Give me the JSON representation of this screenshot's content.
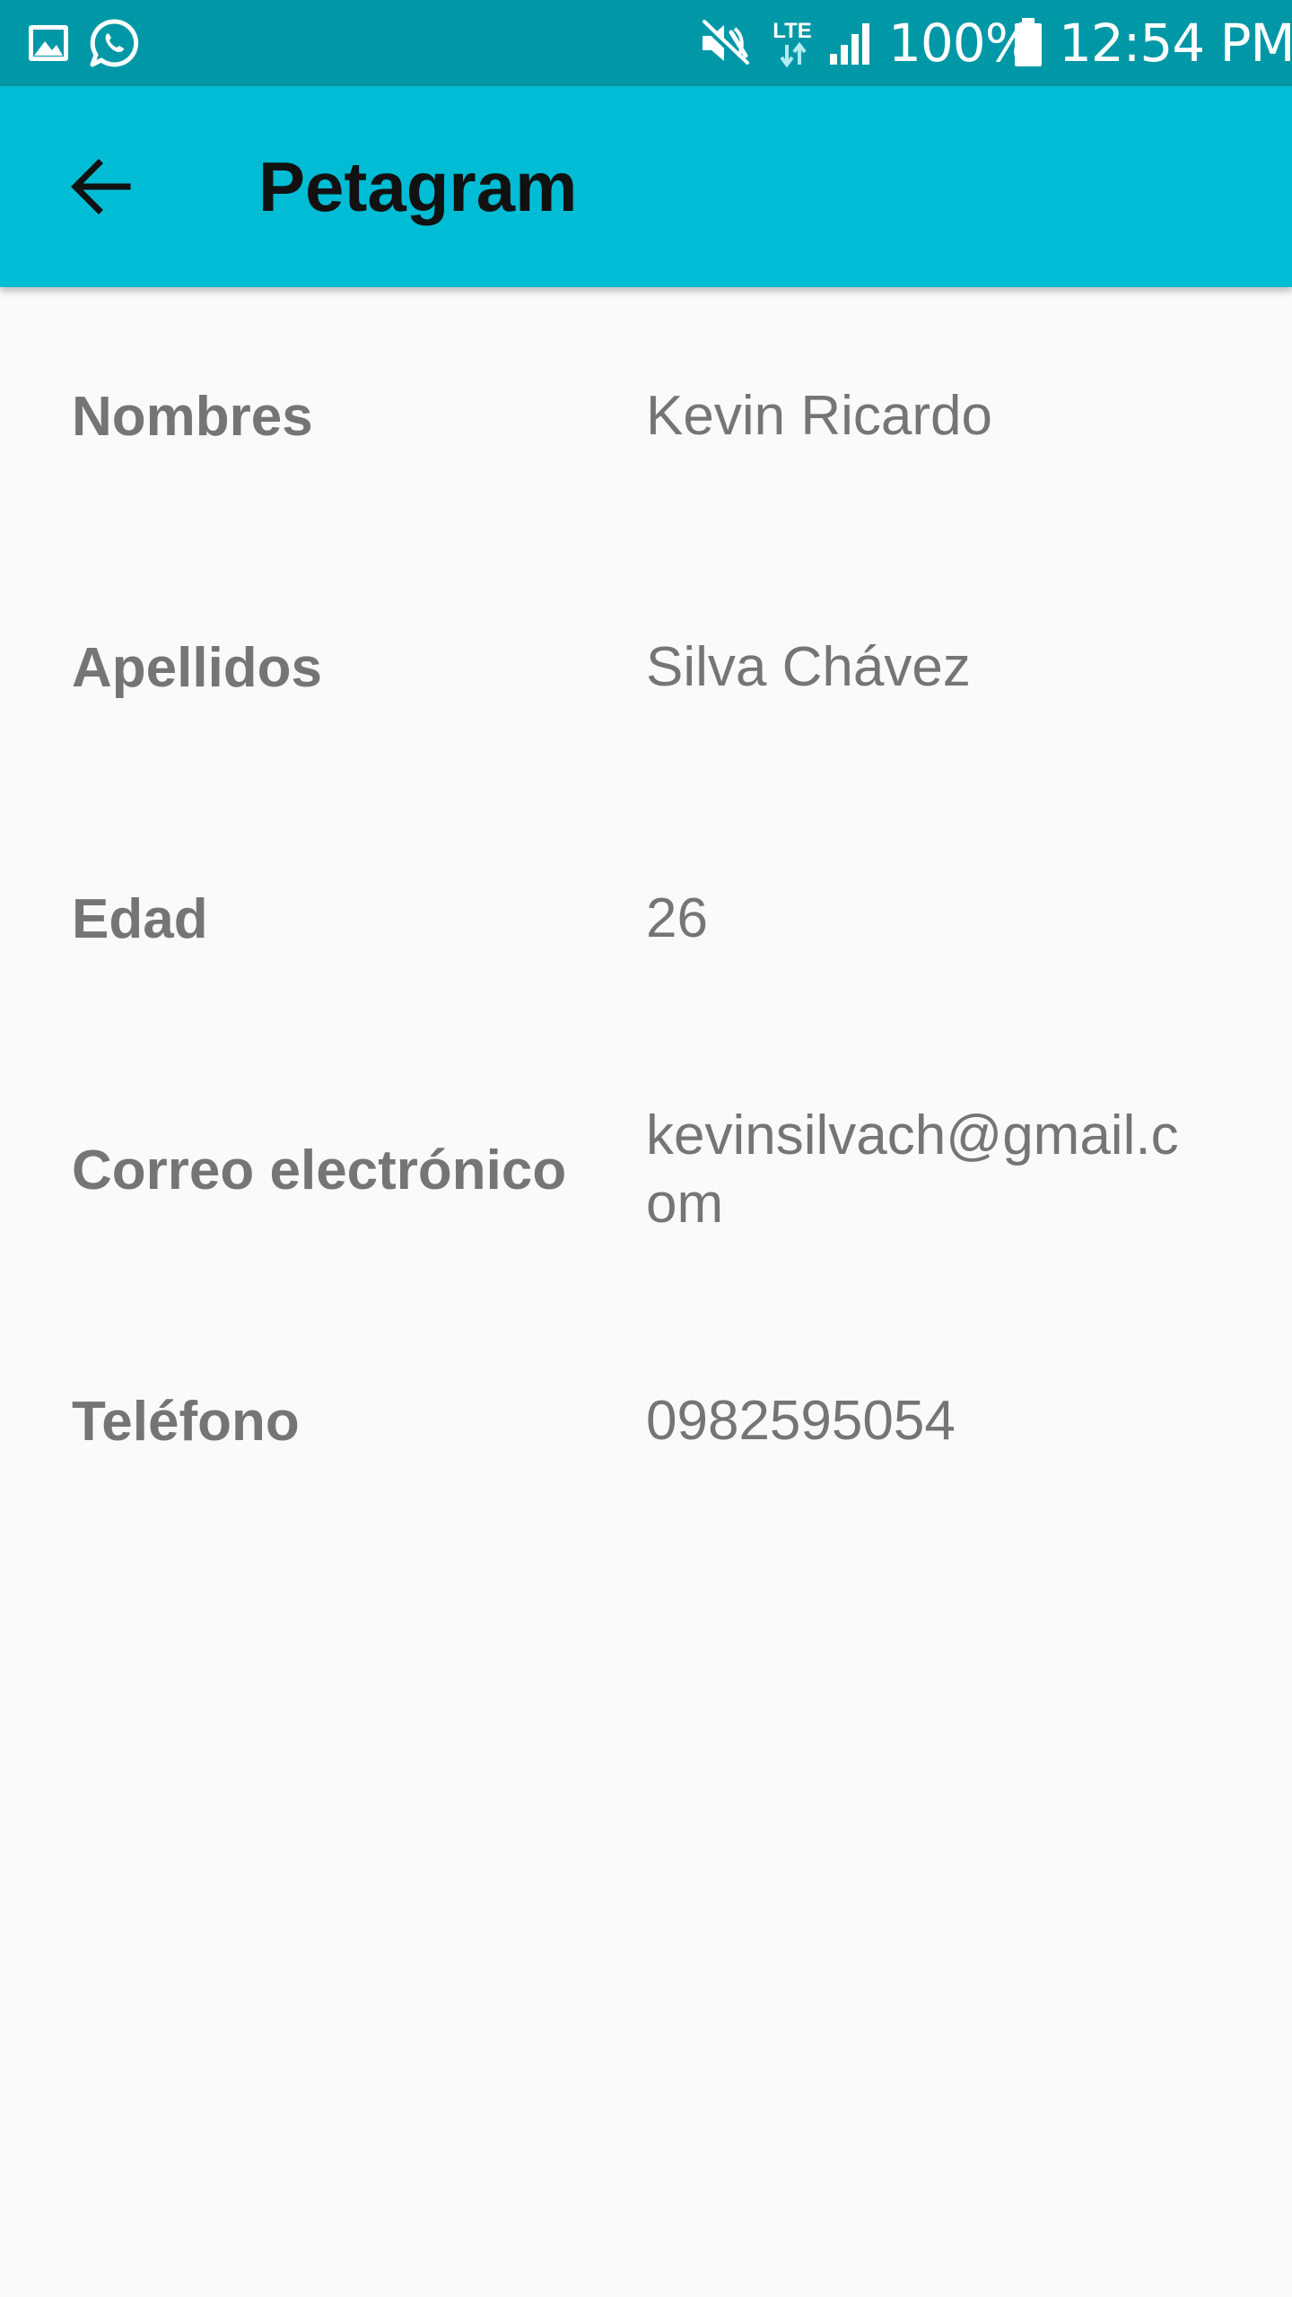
{
  "status_bar": {
    "battery_percent": "100%",
    "time": "12:54 PM",
    "network_type": "LTE",
    "icons": [
      "gallery-icon",
      "whatsapp-icon",
      "mute-icon",
      "lte-icon",
      "signal-icon",
      "battery-icon"
    ]
  },
  "app_bar": {
    "title": "Petagram",
    "back_icon": "arrow-back-icon"
  },
  "profile": {
    "rows": [
      {
        "label": "Nombres",
        "value": "Kevin Ricardo"
      },
      {
        "label": "Apellidos",
        "value": "Silva Chávez"
      },
      {
        "label": "Edad",
        "value": "26"
      },
      {
        "label": "Correo electrónico",
        "value": "kevinsilvach@gmail.com"
      },
      {
        "label": "Teléfono",
        "value": "0982595054"
      }
    ]
  },
  "colors": {
    "status_bar": "#0097a7",
    "app_bar": "#00bcd4",
    "background": "#fafafa",
    "text": "#757575",
    "title": "#111111"
  }
}
